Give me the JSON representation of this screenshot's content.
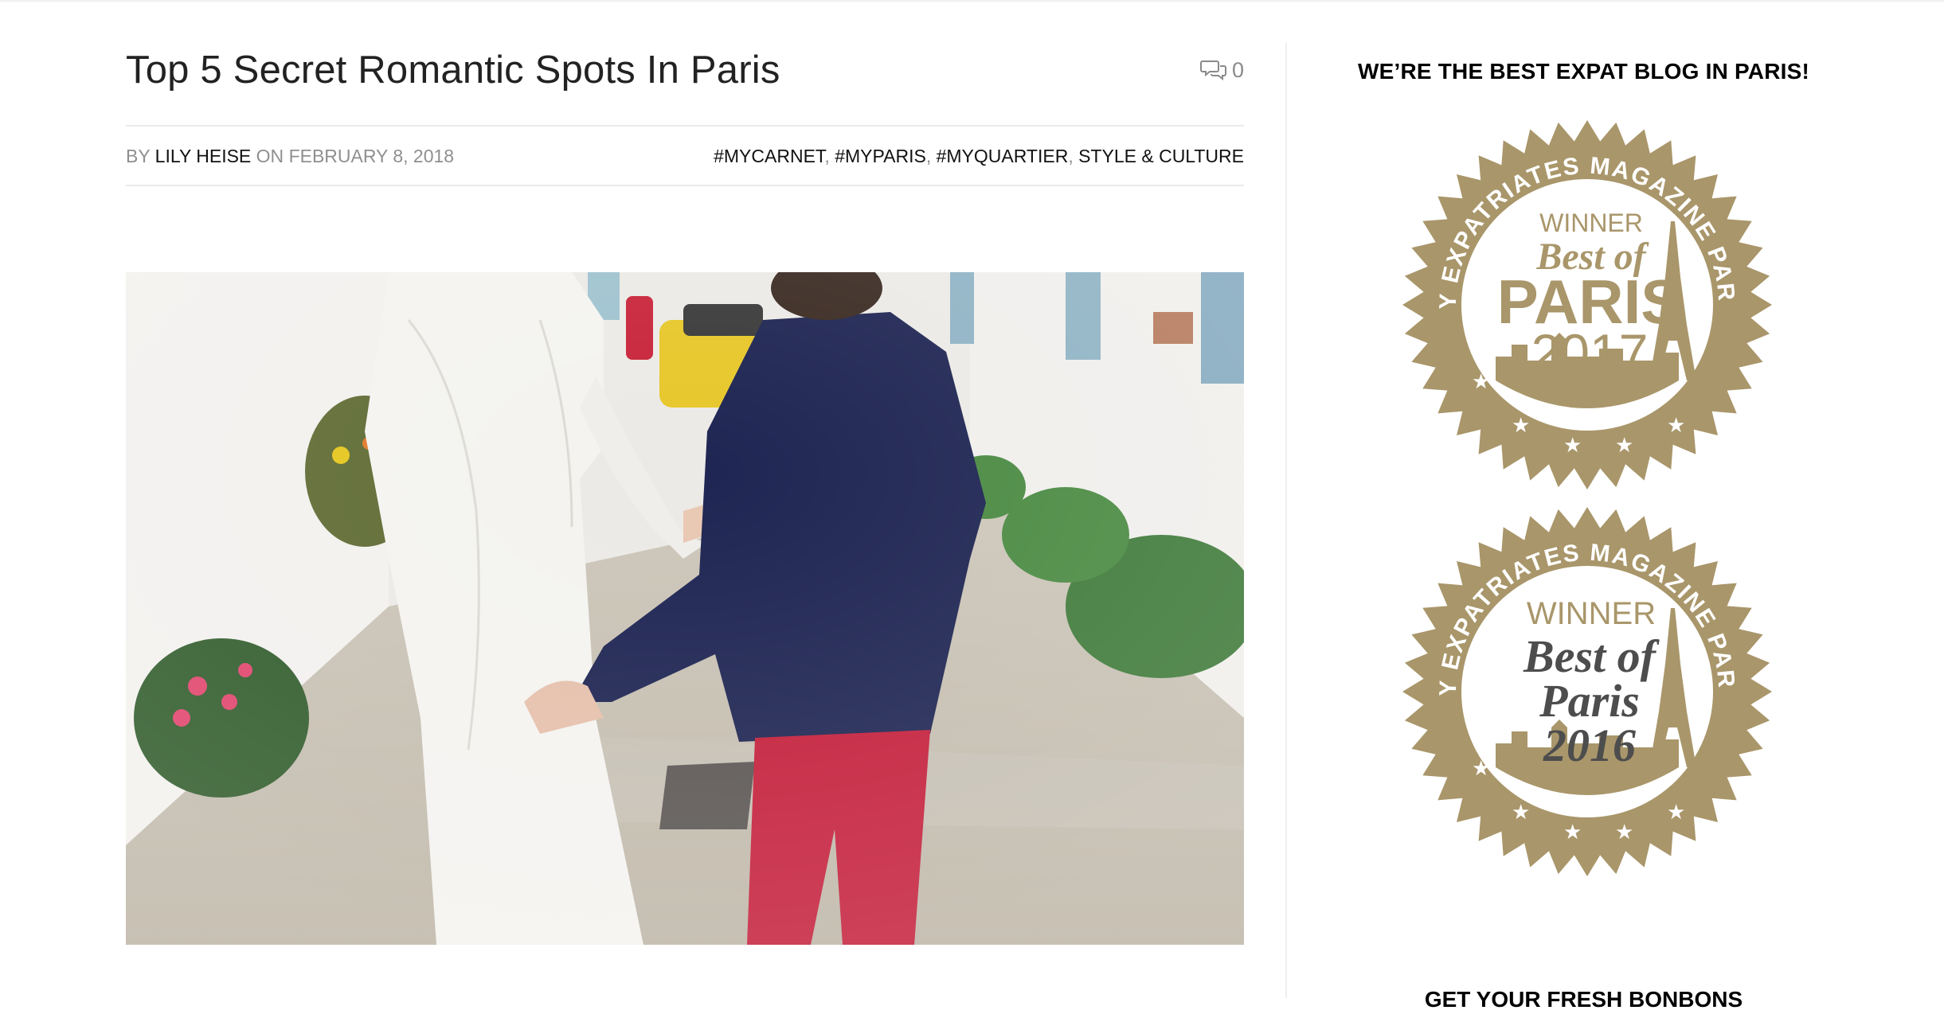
{
  "article": {
    "title": "Top 5 Secret Romantic Spots In Paris",
    "comment_count": "0",
    "meta": {
      "by_label": "BY",
      "author": "LILY HEISE",
      "on_label": "ON",
      "date": "FEBRUARY 8, 2018"
    },
    "tags": [
      "#MYCARNET",
      "#MYPARIS",
      "#MYQUARTIER",
      "STYLE & CULTURE"
    ],
    "tag_separator": ","
  },
  "sidebar": {
    "heading": "WE’RE THE BEST EXPAT BLOG IN PARIS!",
    "badges": [
      {
        "arc_text": "BY EXPATRIATES MAGAZINE PARIS",
        "line1": "WINNER",
        "line2": "Best of",
        "line3": "PARIS",
        "line4": "2017"
      },
      {
        "arc_text": "BY EXPATRIATES MAGAZINE PARIS",
        "line1": "WINNER",
        "line2": "Best of",
        "line3": "Paris",
        "line4": "2016"
      }
    ],
    "next_heading": "GET YOUR FRESH BONBONS"
  },
  "colors": {
    "badge_gold": "#a9966a",
    "badge_text_grey": "#4d4d4d",
    "text_dark": "#222222",
    "text_muted": "#8f8f8f"
  },
  "icons": {
    "comment": "speech-bubbles-icon"
  }
}
